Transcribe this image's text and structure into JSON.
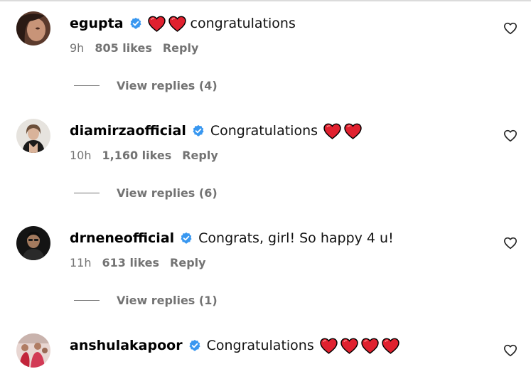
{
  "colors": {
    "heart_red": "#e0212f",
    "verified_blue": "#3897f0",
    "secondary_text": "#737373"
  },
  "icons": {
    "verified": "verified-badge-icon",
    "like": "heart-outline-icon",
    "emoji": "red-heart-emoji"
  },
  "comments": [
    {
      "username": "egupta",
      "text": "congratulations",
      "hearts_before": 2,
      "hearts_after": 0,
      "time": "9h",
      "likes": "805 likes",
      "reply_label": "Reply",
      "view_replies": "View replies (4)"
    },
    {
      "username": "diamirzaofficial",
      "text": "Congratulations",
      "hearts_before": 0,
      "hearts_after": 2,
      "time": "10h",
      "likes": "1,160 likes",
      "reply_label": "Reply",
      "view_replies": "View replies (6)"
    },
    {
      "username": "drneneofficial",
      "text": "Congrats, girl! So happy 4 u!",
      "hearts_before": 0,
      "hearts_after": 0,
      "time": "11h",
      "likes": "613 likes",
      "reply_label": "Reply",
      "view_replies": "View replies (1)"
    },
    {
      "username": "anshulakapoor",
      "text": "Congratulations",
      "hearts_before": 0,
      "hearts_after": 4,
      "time": "",
      "likes": "",
      "reply_label": "",
      "view_replies": ""
    }
  ]
}
